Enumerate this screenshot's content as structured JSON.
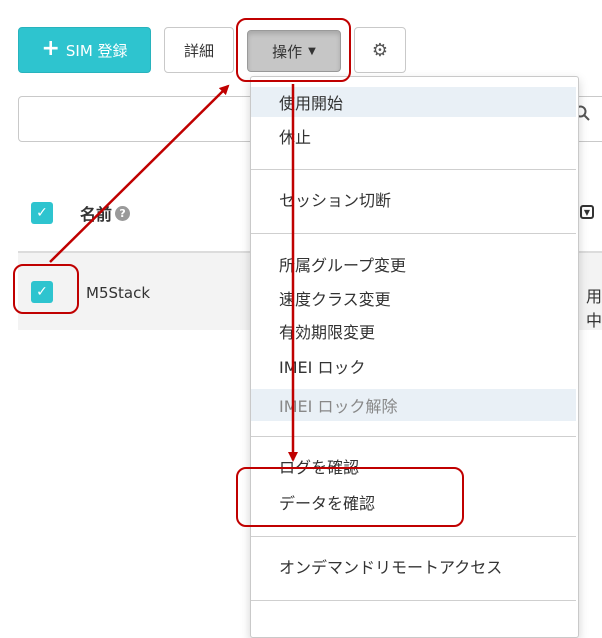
{
  "toolbar": {
    "sim_register_label": "SIM 登録",
    "detail_label": "詳細",
    "operations_label": "操作"
  },
  "table": {
    "name_header": "名前",
    "rows": [
      {
        "name": "M5Stack",
        "status_partial": "用中"
      }
    ]
  },
  "menu": {
    "items": [
      "使用開始",
      "休止",
      "セッション切断",
      "所属グループ変更",
      "速度クラス変更",
      "有効期限変更",
      "IMEI ロック",
      "IMEI ロック解除",
      "ログを確認",
      "データを確認",
      "オンデマンドリモートアクセス"
    ]
  },
  "colors": {
    "accent": "#2ec4cf",
    "annotation": "#c00000"
  }
}
